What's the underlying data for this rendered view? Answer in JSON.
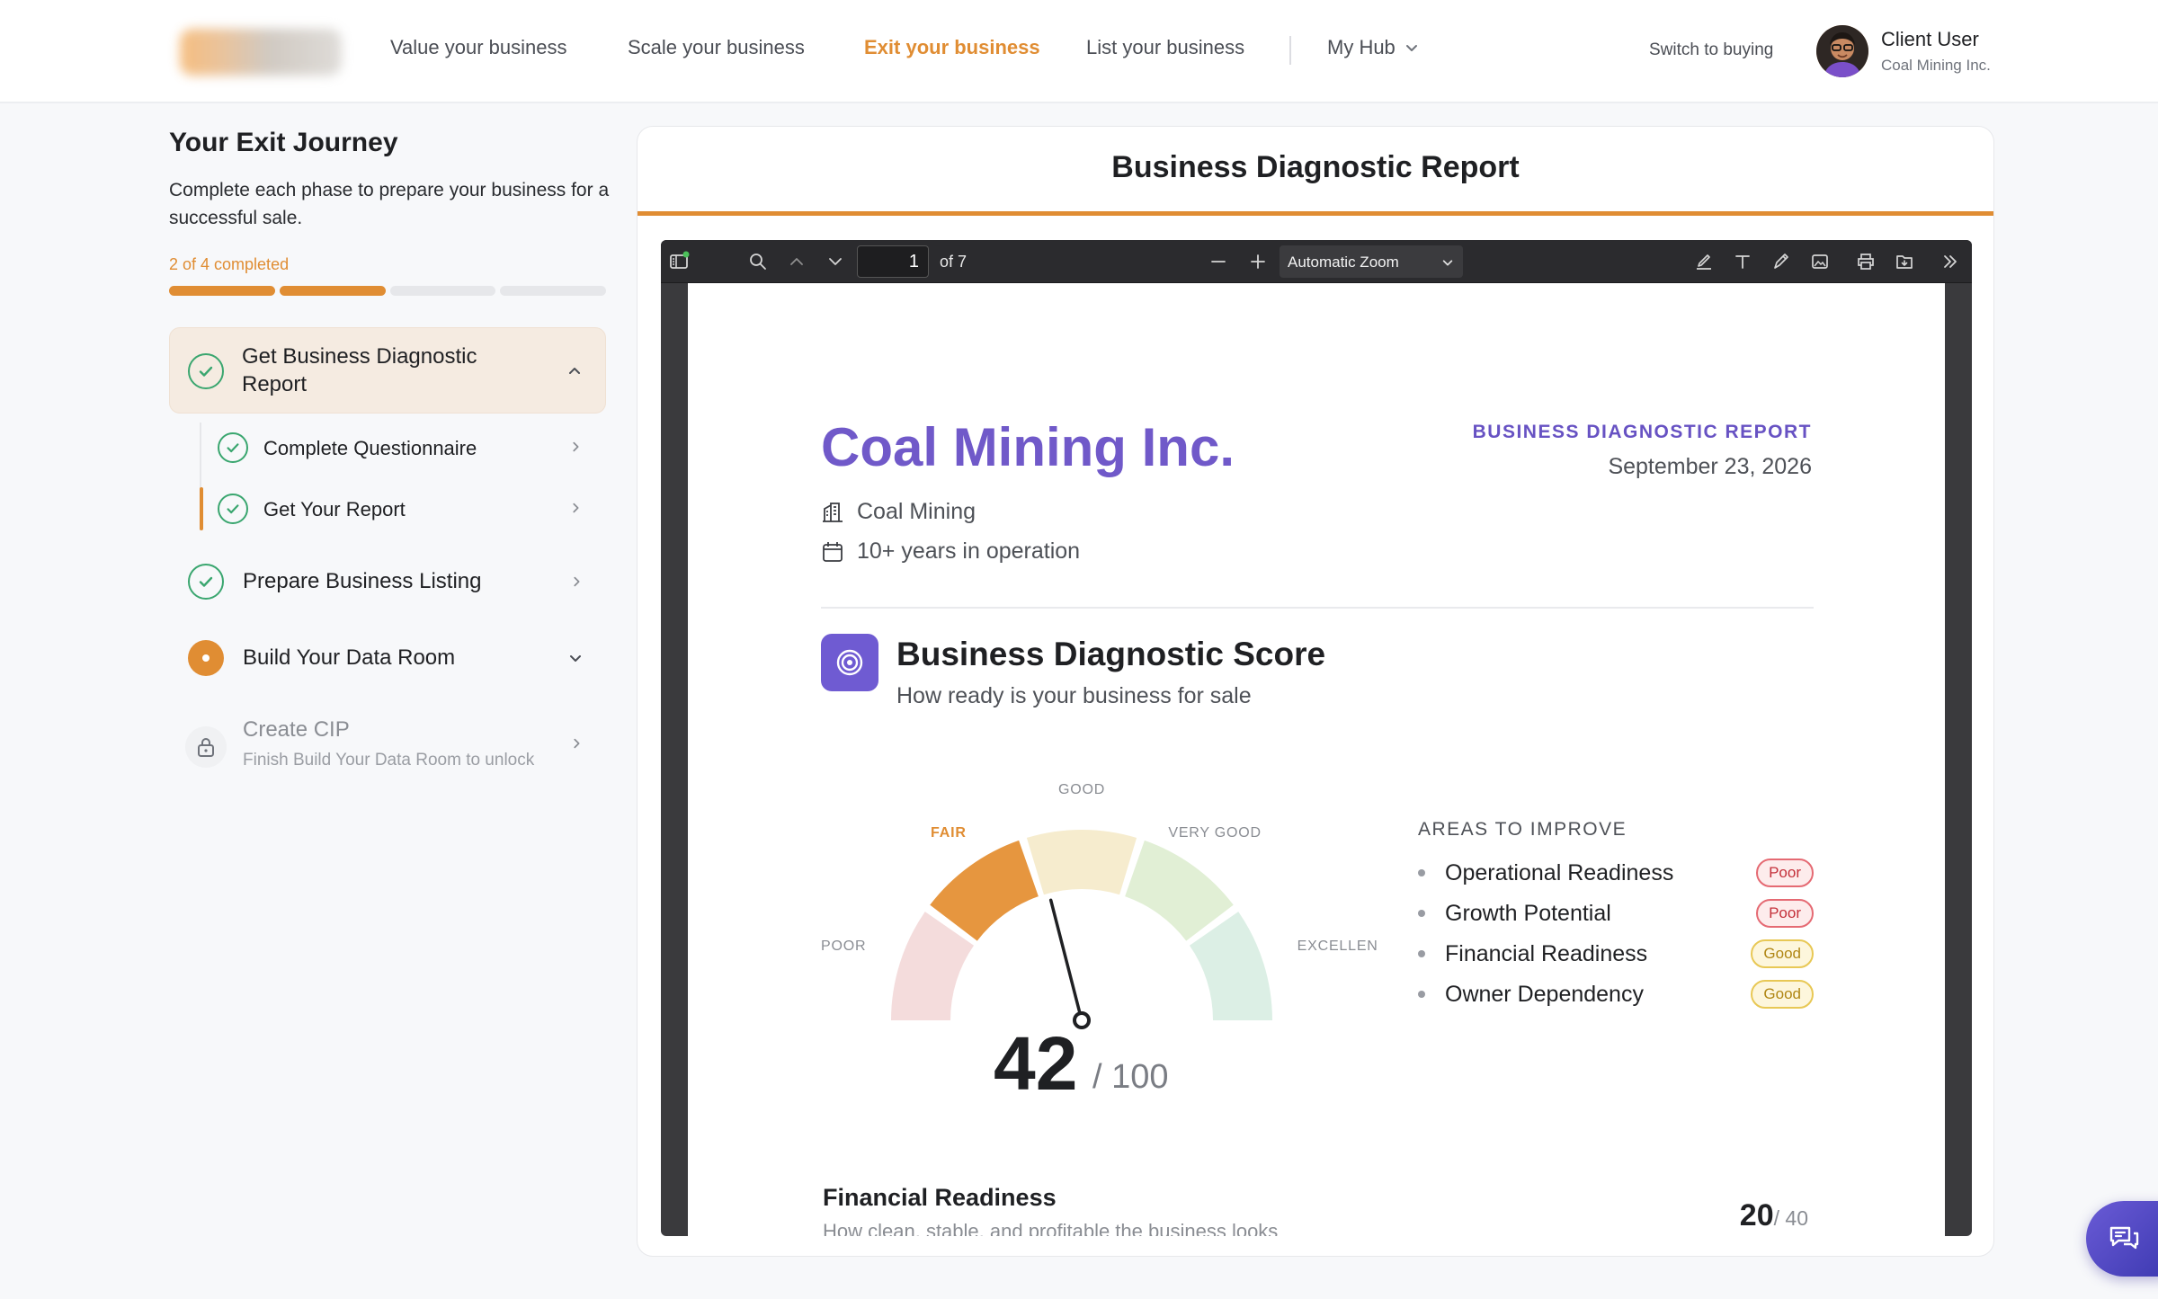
{
  "nav": {
    "links": [
      "Value your business",
      "Scale your business",
      "Exit your business",
      "List your business"
    ],
    "hub": "My Hub",
    "switch": "Switch to buying",
    "user_name": "Client User",
    "user_company": "Coal Mining Inc.",
    "accent": "#e08d33"
  },
  "sidebar": {
    "title": "Your Exit Journey",
    "description": "Complete each phase to prepare your business for a successful sale.",
    "progress_label": "2 of 4 completed",
    "progress": {
      "completed": 2,
      "total": 4
    },
    "steps": [
      {
        "label": "Get Business Diagnostic Report",
        "state": "complete",
        "expanded": true
      },
      {
        "label": "Complete Questionnaire",
        "state": "complete"
      },
      {
        "label": "Get Your Report",
        "state": "complete",
        "selected": true
      },
      {
        "label": "Prepare Business Listing",
        "state": "complete"
      },
      {
        "label": "Build Your Data Room",
        "state": "in-progress"
      },
      {
        "label": "Create CIP",
        "state": "locked",
        "hint": "Finish Build Your Data Room to unlock"
      }
    ]
  },
  "main": {
    "title": "Business Diagnostic Report"
  },
  "pdf": {
    "page_current": "1",
    "page_count": "of 7",
    "zoom": "Automatic Zoom",
    "company": "Coal Mining Inc.",
    "kicker": "BUSINESS DIAGNOSTIC REPORT",
    "date": "September 23, 2026",
    "industry": "Coal Mining",
    "years": "10+ years in operation",
    "score_title": "Business Diagnostic Score",
    "score_subtitle": "How ready is your business for sale",
    "score": "42",
    "score_max": "/ 100",
    "gauge_value": 42,
    "gauge_labels": [
      "POOR",
      "FAIR",
      "GOOD",
      "VERY GOOD",
      "EXCELLENT"
    ],
    "areas_title": "AREAS TO IMPROVE",
    "areas": [
      {
        "name": "Operational Readiness",
        "rating": "Poor"
      },
      {
        "name": "Growth Potential",
        "rating": "Poor"
      },
      {
        "name": "Financial Readiness",
        "rating": "Good"
      },
      {
        "name": "Owner Dependency",
        "rating": "Good"
      }
    ],
    "footer_section": "Financial Readiness",
    "footer_sub": "How clean, stable, and profitable the business looks on",
    "footer_score": "20",
    "footer_score_max": "/ 40"
  }
}
